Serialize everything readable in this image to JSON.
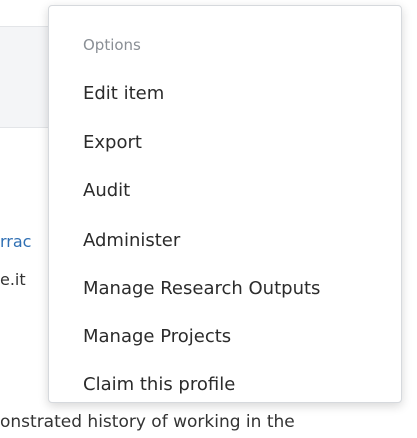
{
  "background": {
    "link_fragment": "rrac",
    "text_fragment": "e.it",
    "bottom_fragment": "onstrated history of working in the"
  },
  "menu": {
    "header": "Options",
    "items": [
      {
        "label": "Edit item"
      },
      {
        "label": "Export"
      },
      {
        "label": "Audit"
      },
      {
        "label": "Administer"
      },
      {
        "label": "Manage Research Outputs"
      },
      {
        "label": "Manage Projects"
      },
      {
        "label": "Claim this profile"
      }
    ]
  }
}
